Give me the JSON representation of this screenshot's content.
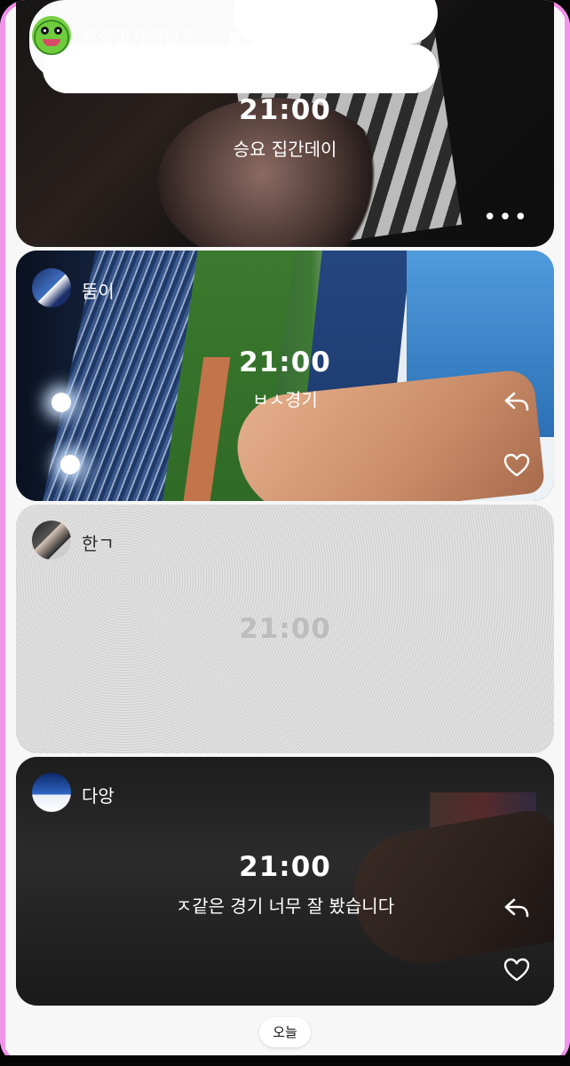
{
  "posts": [
    {
      "name": "박정민자이언츠",
      "time": "21:00",
      "caption": "승요 집간데이"
    },
    {
      "name": "뚬이",
      "time": "21:00",
      "caption": "ㅂㅅ경기"
    },
    {
      "name": "한ㄱ",
      "time": "21:00",
      "caption": ""
    },
    {
      "name": "다앙",
      "time": "21:00",
      "caption": "ㅈ같은 경기 너무 잘 봤습니다"
    }
  ],
  "today_label": "오늘",
  "more_label": "•••",
  "icons": [
    "reply-icon",
    "heart-icon",
    "more-icon"
  ],
  "colors": {
    "frame_pink": "#f394ec"
  }
}
